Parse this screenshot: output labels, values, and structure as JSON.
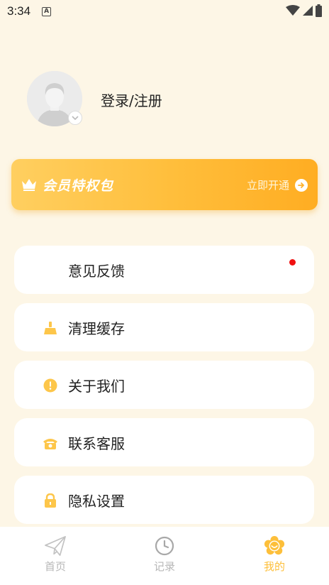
{
  "status_bar": {
    "time": "3:34",
    "notif_letter": "A"
  },
  "profile": {
    "login_label": "登录/注册"
  },
  "vip": {
    "title": "会员特权包",
    "action_label": "立即开通"
  },
  "menu": {
    "items": [
      {
        "label": "意见反馈",
        "icon": "feedback-icon",
        "has_dot": true
      },
      {
        "label": "清理缓存",
        "icon": "broom-icon"
      },
      {
        "label": "关于我们",
        "icon": "info-alert-icon"
      },
      {
        "label": "联系客服",
        "icon": "phone-icon"
      },
      {
        "label": "隐私设置",
        "icon": "lock-icon"
      }
    ]
  },
  "tabs": {
    "items": [
      {
        "label": "首页",
        "icon": "paper-plane-icon"
      },
      {
        "label": "记录",
        "icon": "clock-icon"
      },
      {
        "label": "我的",
        "icon": "flower-smile-icon",
        "active": true
      }
    ]
  },
  "colors": {
    "accent": "#fdbf3a",
    "background": "#fdf6e6",
    "badge_red": "#f01010"
  }
}
